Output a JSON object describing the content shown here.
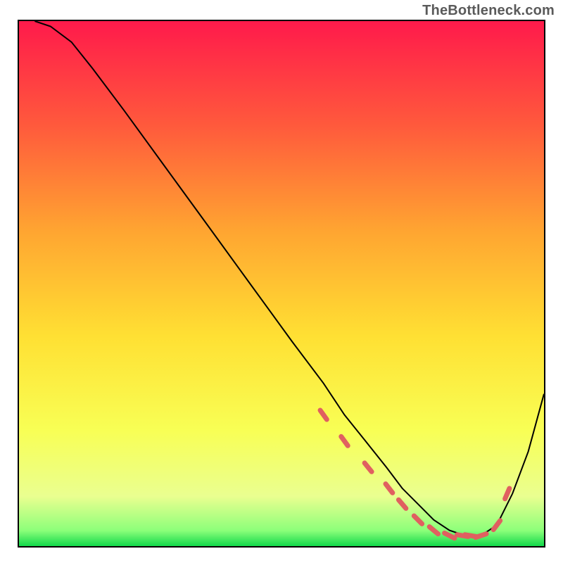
{
  "attribution": "TheBottleneck.com",
  "chart_data": {
    "type": "line",
    "title": "",
    "xlabel": "",
    "ylabel": "",
    "xlim": [
      0,
      100
    ],
    "ylim": [
      0,
      100
    ],
    "grid": false,
    "legend": false,
    "gradient_stops": [
      {
        "offset": 0.0,
        "color": "#ff1a4b"
      },
      {
        "offset": 0.2,
        "color": "#ff5a3c"
      },
      {
        "offset": 0.4,
        "color": "#ffa531"
      },
      {
        "offset": 0.6,
        "color": "#ffe033"
      },
      {
        "offset": 0.78,
        "color": "#f8ff55"
      },
      {
        "offset": 0.905,
        "color": "#eaff90"
      },
      {
        "offset": 0.97,
        "color": "#8dff7a"
      },
      {
        "offset": 1.0,
        "color": "#12d94b"
      }
    ],
    "series": [
      {
        "name": "curve",
        "color": "#000000",
        "x": [
          3,
          6,
          10,
          14,
          20,
          28,
          36,
          44,
          52,
          58,
          62,
          66,
          70,
          73,
          76,
          79,
          82,
          85,
          88,
          91,
          94,
          97,
          100
        ],
        "y": [
          100,
          99,
          96,
          91,
          83,
          72,
          61,
          50,
          39,
          31,
          25,
          20,
          15,
          11,
          8,
          5,
          3,
          2,
          2,
          4,
          10,
          18,
          29
        ]
      }
    ],
    "points": {
      "name": "markers",
      "color": "#e06060",
      "shape": "dash-dot",
      "x": [
        58,
        62,
        66.5,
        70.5,
        73,
        76,
        79,
        82,
        84.5,
        86,
        88,
        91,
        93
      ],
      "y": [
        25,
        20,
        15,
        11,
        8,
        5,
        3,
        2,
        2,
        2,
        2,
        4,
        10
      ]
    }
  }
}
